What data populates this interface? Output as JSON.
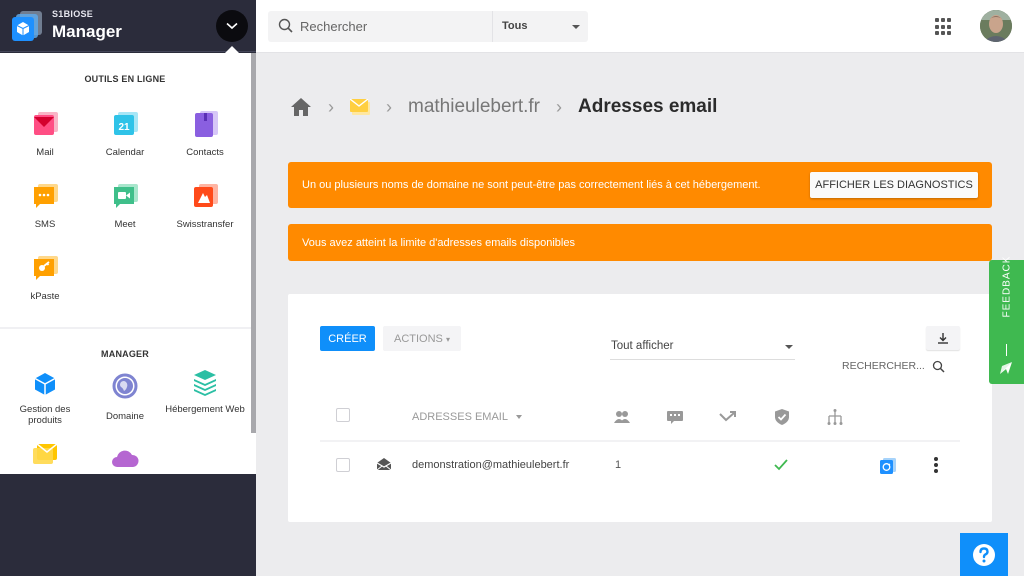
{
  "brand": {
    "org": "S1BIOSE",
    "name": "Manager"
  },
  "menu": {
    "online_tools_title": "OUTILS EN LIGNE",
    "online_tools": [
      {
        "label": "Mail",
        "icon": "mail-app-icon"
      },
      {
        "label": "Calendar",
        "icon": "calendar-app-icon",
        "badge": "21"
      },
      {
        "label": "Contacts",
        "icon": "contacts-app-icon"
      },
      {
        "label": "SMS",
        "icon": "sms-app-icon"
      },
      {
        "label": "Meet",
        "icon": "meet-app-icon"
      },
      {
        "label": "Swisstransfer",
        "icon": "swisstransfer-app-icon"
      },
      {
        "label": "kPaste",
        "icon": "kpaste-app-icon"
      }
    ],
    "manager_title": "MANAGER",
    "manager_items": [
      {
        "label": "Gestion des produits",
        "icon": "cube-icon"
      },
      {
        "label": "Domaine",
        "icon": "globe-icon"
      },
      {
        "label": "Hébergement Web",
        "icon": "layers-icon"
      },
      {
        "label": "",
        "icon": "mail-service-icon"
      },
      {
        "label": "",
        "icon": "cloud-icon"
      }
    ]
  },
  "topbar": {
    "search_placeholder": "Rechercher",
    "scope_value": "Tous"
  },
  "breadcrumb": {
    "domain": "mathieulebert.fr",
    "current": "Adresses email"
  },
  "alerts": [
    {
      "text": "Un ou plusieurs noms de domaine ne sont peut-être pas correctement liés à cet hébergement.",
      "action": "AFFICHER LES DIAGNOSTICS"
    },
    {
      "text": "Vous avez atteint la limite d'adresses emails disponibles"
    }
  ],
  "toolbar": {
    "create_label": "CRÉER",
    "actions_label": "ACTIONS",
    "filter_value": "Tout afficher",
    "search_label": "RECHERCHER..."
  },
  "table": {
    "columns": {
      "email": "ADRESSES EMAIL",
      "icon_columns": [
        "aliases-icon",
        "autoreply-icon",
        "redirect-icon",
        "security-icon",
        "hierarchy-icon"
      ]
    },
    "rows": [
      {
        "email": "demonstration@mathieulebert.fr",
        "aliases": "1",
        "security_ok": true
      }
    ]
  },
  "feedback": {
    "label": "FEEDBACK"
  },
  "colors": {
    "accent": "#0f8ffa",
    "warning": "#ff8a00",
    "success": "#3fb950",
    "sidebar": "#2b2c3b"
  }
}
